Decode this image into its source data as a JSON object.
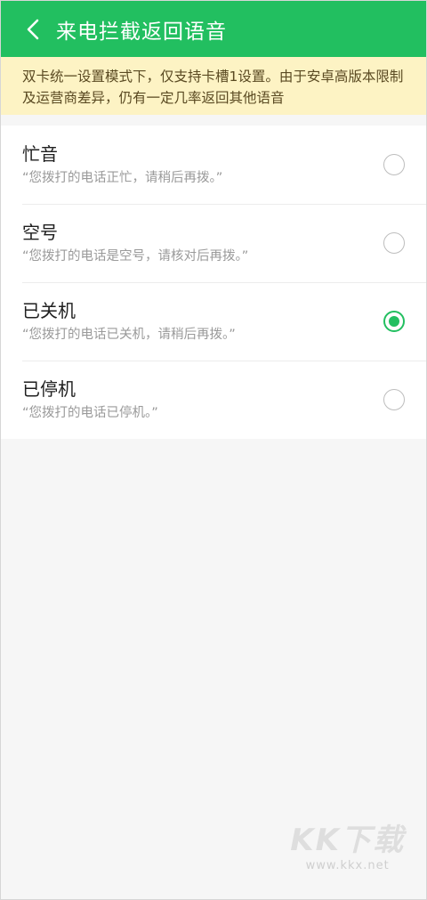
{
  "header": {
    "title": "来电拦截返回语音",
    "back_icon": "chevron-left-icon"
  },
  "notice": {
    "text": "双卡统一设置模式下，仅支持卡槽1设置。由于安卓高版本限制及运营商差异，仍有一定几率返回其他语音"
  },
  "options": [
    {
      "title": "忙音",
      "subtitle": "“您拨打的电话正忙，请稍后再拨。”",
      "selected": false
    },
    {
      "title": "空号",
      "subtitle": "“您拨打的电话是空号，请核对后再拨。”",
      "selected": false
    },
    {
      "title": "已关机",
      "subtitle": "“您拨打的电话已关机，请稍后再拨。”",
      "selected": true
    },
    {
      "title": "已停机",
      "subtitle": "“您拨打的电话已停机。”",
      "selected": false
    }
  ],
  "watermark": {
    "logo": "KK下载",
    "url": "www.kkx.net"
  },
  "colors": {
    "accent": "#22bf60",
    "notice_bg": "#fdf3c4",
    "background": "#f6f6f6"
  }
}
